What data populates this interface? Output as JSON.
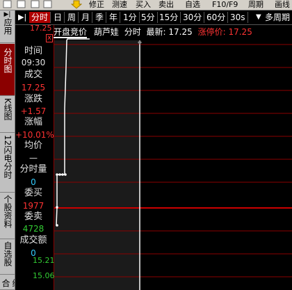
{
  "toolbar": {
    "items": [
      {
        "label": "修正",
        "icon": "edit-icon"
      },
      {
        "label": "测速",
        "icon": ""
      },
      {
        "label": "买入",
        "icon": ""
      },
      {
        "label": "卖出",
        "icon": ""
      },
      {
        "label": "自选",
        "icon": ""
      },
      {
        "label": "F10/F9",
        "icon": ""
      },
      {
        "label": "周期",
        "icon": ""
      },
      {
        "label": "画线",
        "icon": ""
      }
    ]
  },
  "left_tabs": [
    "应用",
    "分时图",
    "K线图",
    "12闪电分时",
    "个股资料",
    "自选股",
    "综合"
  ],
  "period_tabs": [
    "分时",
    "日",
    "周",
    "月",
    "季",
    "年",
    "1分",
    "5分",
    "15分",
    "30分",
    "60分",
    "30s",
    "多周期"
  ],
  "info": {
    "time_label": "时间",
    "time_value": "09:30",
    "deal_label": "成交",
    "deal_value": "17.25",
    "change_label": "涨跌",
    "change_value": "+1.57",
    "pct_label": "涨幅",
    "pct_value": "+10.01%",
    "avg_label": "均价",
    "avg_value": "—",
    "vol_label": "分时量",
    "vol_value": "0",
    "bid_label": "委买",
    "bid_value": "1977",
    "ask_label": "委卖",
    "ask_value": "4728",
    "amount_label": "成交额",
    "amount_value": "0"
  },
  "header": {
    "auction": "开盘竞价",
    "name": "葫芦娃",
    "type": "分时",
    "latest_label": "最新:",
    "latest_value": "17.25",
    "limit_label": "涨停价:",
    "limit_value": "17.25"
  },
  "y_axis": [
    "17.25",
    "15.21",
    "15.06"
  ],
  "close_marker": "x",
  "colors": {
    "up": "#ff3333",
    "down": "#33cc33",
    "grid": "#8b0000",
    "price_line": "#ffffff",
    "yellow": "#ffff00"
  }
}
